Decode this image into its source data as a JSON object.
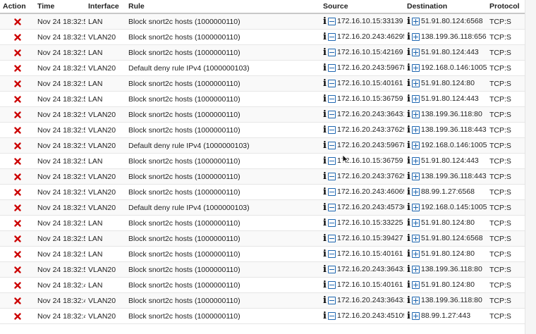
{
  "table": {
    "headers": {
      "action": "Action",
      "time": "Time",
      "interface": "Interface",
      "rule": "Rule",
      "source": "Source",
      "destination": "Destination",
      "protocol": "Protocol"
    },
    "icons": {
      "action": "block-x-icon",
      "info": "info-icon",
      "source_op": "minus-box-icon",
      "dest_op": "plus-box-icon"
    },
    "colors": {
      "block": "#cc0000",
      "op_icon": "#1f67b1"
    },
    "rows": [
      {
        "time": "Nov 24 18:32:53",
        "interface": "LAN",
        "rule": "Block snort2c hosts (1000000110)",
        "source": "172.16.10.15:33139",
        "destination": "51.91.80.124:6568",
        "protocol": "TCP:S"
      },
      {
        "time": "Nov 24 18:32:53",
        "interface": "VLAN20",
        "rule": "Block snort2c hosts (1000000110)",
        "source": "172.16.20.243:46295",
        "destination": "138.199.36.118:6568",
        "protocol": "TCP:S"
      },
      {
        "time": "Nov 24 18:32:53",
        "interface": "LAN",
        "rule": "Block snort2c hosts (1000000110)",
        "source": "172.16.10.15:42169",
        "destination": "51.91.80.124:443",
        "protocol": "TCP:S"
      },
      {
        "time": "Nov 24 18:32:53",
        "interface": "VLAN20",
        "rule": "Default deny rule IPv4 (1000000103)",
        "source": "172.16.20.243:59678",
        "destination": "192.168.0.146:10050",
        "protocol": "TCP:S"
      },
      {
        "time": "Nov 24 18:32:52",
        "interface": "LAN",
        "rule": "Block snort2c hosts (1000000110)",
        "source": "172.16.10.15:40161",
        "destination": "51.91.80.124:80",
        "protocol": "TCP:S"
      },
      {
        "time": "Nov 24 18:32:52",
        "interface": "LAN",
        "rule": "Block snort2c hosts (1000000110)",
        "source": "172.16.10.15:36759",
        "destination": "51.91.80.124:443",
        "protocol": "TCP:S"
      },
      {
        "time": "Nov 24 18:32:52",
        "interface": "VLAN20",
        "rule": "Block snort2c hosts (1000000110)",
        "source": "172.16.20.243:36431",
        "destination": "138.199.36.118:80",
        "protocol": "TCP:S"
      },
      {
        "time": "Nov 24 18:32:52",
        "interface": "VLAN20",
        "rule": "Block snort2c hosts (1000000110)",
        "source": "172.16.20.243:37629",
        "destination": "138.199.36.118:443",
        "protocol": "TCP:S"
      },
      {
        "time": "Nov 24 18:32:52",
        "interface": "VLAN20",
        "rule": "Default deny rule IPv4 (1000000103)",
        "source": "172.16.20.243:59678",
        "destination": "192.168.0.146:10050",
        "protocol": "TCP:S"
      },
      {
        "time": "Nov 24 18:32:51",
        "interface": "LAN",
        "rule": "Block snort2c hosts (1000000110)",
        "source": "172.16.10.15:36759",
        "destination": "51.91.80.124:443",
        "protocol": "TCP:S"
      },
      {
        "time": "Nov 24 18:32:51",
        "interface": "VLAN20",
        "rule": "Block snort2c hosts (1000000110)",
        "source": "172.16.20.243:37629",
        "destination": "138.199.36.118:443",
        "protocol": "TCP:S"
      },
      {
        "time": "Nov 24 18:32:51",
        "interface": "VLAN20",
        "rule": "Block snort2c hosts (1000000110)",
        "source": "172.16.20.243:46069",
        "destination": "88.99.1.27:6568",
        "protocol": "TCP:S"
      },
      {
        "time": "Nov 24 18:32:51",
        "interface": "VLAN20",
        "rule": "Default deny rule IPv4 (1000000103)",
        "source": "172.16.20.243:45736",
        "destination": "192.168.0.145:10050",
        "protocol": "TCP:S"
      },
      {
        "time": "Nov 24 18:32:51",
        "interface": "LAN",
        "rule": "Block snort2c hosts (1000000110)",
        "source": "172.16.10.15:33225",
        "destination": "51.91.80.124:80",
        "protocol": "TCP:S"
      },
      {
        "time": "Nov 24 18:32:50",
        "interface": "LAN",
        "rule": "Block snort2c hosts (1000000110)",
        "source": "172.16.10.15:39427",
        "destination": "51.91.80.124:6568",
        "protocol": "TCP:S"
      },
      {
        "time": "Nov 24 18:32:50",
        "interface": "LAN",
        "rule": "Block snort2c hosts (1000000110)",
        "source": "172.16.10.15:40161",
        "destination": "51.91.80.124:80",
        "protocol": "TCP:S"
      },
      {
        "time": "Nov 24 18:32:50",
        "interface": "VLAN20",
        "rule": "Block snort2c hosts (1000000110)",
        "source": "172.16.20.243:36431",
        "destination": "138.199.36.118:80",
        "protocol": "TCP:S"
      },
      {
        "time": "Nov 24 18:32:49",
        "interface": "LAN",
        "rule": "Block snort2c hosts (1000000110)",
        "source": "172.16.10.15:40161",
        "destination": "51.91.80.124:80",
        "protocol": "TCP:S"
      },
      {
        "time": "Nov 24 18:32:49",
        "interface": "VLAN20",
        "rule": "Block snort2c hosts (1000000110)",
        "source": "172.16.20.243:36431",
        "destination": "138.199.36.118:80",
        "protocol": "TCP:S"
      },
      {
        "time": "Nov 24 18:32:49",
        "interface": "VLAN20",
        "rule": "Block snort2c hosts (1000000110)",
        "source": "172.16.20.243:45109",
        "destination": "88.99.1.27:443",
        "protocol": "TCP:S"
      }
    ]
  }
}
